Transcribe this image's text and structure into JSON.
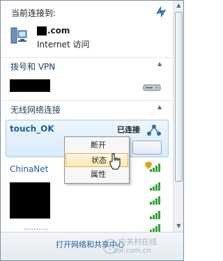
{
  "header": {
    "title": "当前连接到:"
  },
  "current_network": {
    "name": ".com",
    "access": "Internet 访问"
  },
  "sections": {
    "vpn": "拨号和 VPN",
    "wireless": "无线网络连接"
  },
  "wifi_list": {
    "selected": {
      "ssid": "touch_OK",
      "status": "已连接"
    },
    "second": {
      "ssid": "ChinaNet"
    },
    "partial_text": "..........",
    "bars": "strong"
  },
  "context_menu": {
    "items": [
      "断开",
      "状态",
      "属性"
    ],
    "highlighted": "状态"
  },
  "footer": {
    "link": "打开网络和共享中心"
  },
  "watermark": {
    "line1": "中关村在线",
    "line2": "zol.com.cn"
  },
  "colors": {
    "link": "#1f5d9a",
    "menu_highlight": "#ffe9b2",
    "signal_green": "#37a23a"
  },
  "icons": [
    "network-icon",
    "refresh-icon",
    "vpn-modem-icon",
    "connected-icon",
    "shield-icon",
    "signal-bars-icon",
    "cursor-icon"
  ]
}
